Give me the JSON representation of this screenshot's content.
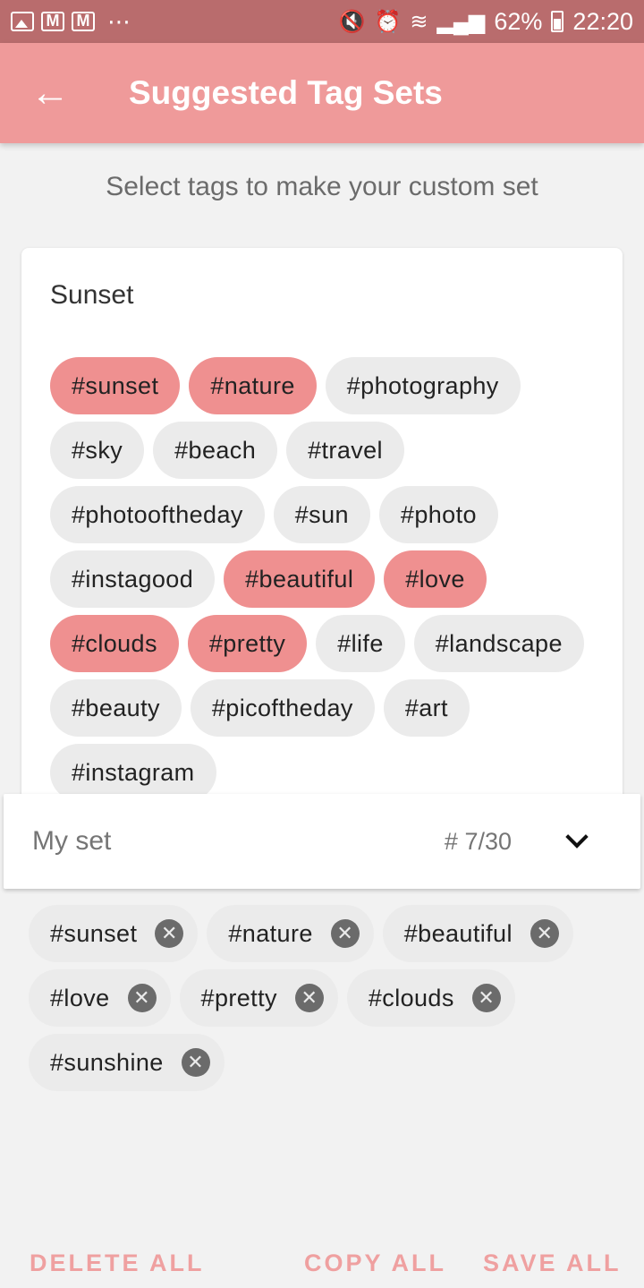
{
  "status_bar": {
    "battery": "62%",
    "time": "22:20",
    "dots": "⋯",
    "mail_glyph": "M"
  },
  "app_bar": {
    "back_icon": "←",
    "title": "Suggested Tag Sets"
  },
  "subtitle": "Select tags to make your custom set",
  "card": {
    "title": "Sunset",
    "tags": [
      {
        "label": "#sunset",
        "selected": true
      },
      {
        "label": "#nature",
        "selected": true
      },
      {
        "label": "#photography",
        "selected": false
      },
      {
        "label": "#sky",
        "selected": false
      },
      {
        "label": "#beach",
        "selected": false
      },
      {
        "label": "#travel",
        "selected": false
      },
      {
        "label": "#photooftheday",
        "selected": false
      },
      {
        "label": "#sun",
        "selected": false
      },
      {
        "label": "#photo",
        "selected": false
      },
      {
        "label": "#instagood",
        "selected": false
      },
      {
        "label": "#beautiful",
        "selected": true
      },
      {
        "label": "#love",
        "selected": true
      },
      {
        "label": "#clouds",
        "selected": true
      },
      {
        "label": "#pretty",
        "selected": true
      },
      {
        "label": "#life",
        "selected": false
      },
      {
        "label": "#landscape",
        "selected": false
      },
      {
        "label": "#beauty",
        "selected": false
      },
      {
        "label": "#picoftheday",
        "selected": false
      },
      {
        "label": "#art",
        "selected": false
      },
      {
        "label": "#instagram",
        "selected": false
      }
    ]
  },
  "my_set": {
    "label": "My set",
    "count": "# 7/30",
    "remove_glyph": "✕",
    "tags": [
      "#sunset",
      "#nature",
      "#beautiful",
      "#love",
      "#pretty",
      "#clouds",
      "#sunshine"
    ]
  },
  "actions": {
    "delete_all": "DELETE ALL",
    "copy_all": "COPY ALL",
    "save_all": "SAVE ALL"
  },
  "colors": {
    "app_bar": "#ef9a9a",
    "status_bar": "#b96c6d",
    "selected_chip": "#ef9090",
    "chip": "#ebebeb",
    "action_text": "#efa0a0"
  }
}
